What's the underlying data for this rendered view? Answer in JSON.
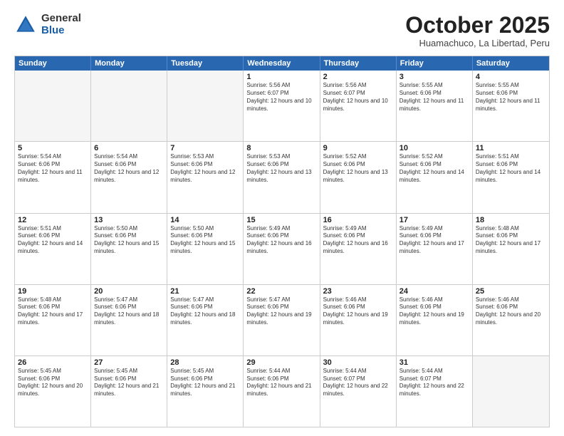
{
  "logo": {
    "general": "General",
    "blue": "Blue"
  },
  "header": {
    "month": "October 2025",
    "location": "Huamachuco, La Libertad, Peru"
  },
  "weekdays": [
    "Sunday",
    "Monday",
    "Tuesday",
    "Wednesday",
    "Thursday",
    "Friday",
    "Saturday"
  ],
  "rows": [
    [
      {
        "day": "",
        "empty": true
      },
      {
        "day": "",
        "empty": true
      },
      {
        "day": "",
        "empty": true
      },
      {
        "day": "1",
        "sunrise": "5:56 AM",
        "sunset": "6:07 PM",
        "daylight": "12 hours and 10 minutes."
      },
      {
        "day": "2",
        "sunrise": "5:56 AM",
        "sunset": "6:07 PM",
        "daylight": "12 hours and 10 minutes."
      },
      {
        "day": "3",
        "sunrise": "5:55 AM",
        "sunset": "6:06 PM",
        "daylight": "12 hours and 11 minutes."
      },
      {
        "day": "4",
        "sunrise": "5:55 AM",
        "sunset": "6:06 PM",
        "daylight": "12 hours and 11 minutes."
      }
    ],
    [
      {
        "day": "5",
        "sunrise": "5:54 AM",
        "sunset": "6:06 PM",
        "daylight": "12 hours and 11 minutes."
      },
      {
        "day": "6",
        "sunrise": "5:54 AM",
        "sunset": "6:06 PM",
        "daylight": "12 hours and 12 minutes."
      },
      {
        "day": "7",
        "sunrise": "5:53 AM",
        "sunset": "6:06 PM",
        "daylight": "12 hours and 12 minutes."
      },
      {
        "day": "8",
        "sunrise": "5:53 AM",
        "sunset": "6:06 PM",
        "daylight": "12 hours and 13 minutes."
      },
      {
        "day": "9",
        "sunrise": "5:52 AM",
        "sunset": "6:06 PM",
        "daylight": "12 hours and 13 minutes."
      },
      {
        "day": "10",
        "sunrise": "5:52 AM",
        "sunset": "6:06 PM",
        "daylight": "12 hours and 14 minutes."
      },
      {
        "day": "11",
        "sunrise": "5:51 AM",
        "sunset": "6:06 PM",
        "daylight": "12 hours and 14 minutes."
      }
    ],
    [
      {
        "day": "12",
        "sunrise": "5:51 AM",
        "sunset": "6:06 PM",
        "daylight": "12 hours and 14 minutes."
      },
      {
        "day": "13",
        "sunrise": "5:50 AM",
        "sunset": "6:06 PM",
        "daylight": "12 hours and 15 minutes."
      },
      {
        "day": "14",
        "sunrise": "5:50 AM",
        "sunset": "6:06 PM",
        "daylight": "12 hours and 15 minutes."
      },
      {
        "day": "15",
        "sunrise": "5:49 AM",
        "sunset": "6:06 PM",
        "daylight": "12 hours and 16 minutes."
      },
      {
        "day": "16",
        "sunrise": "5:49 AM",
        "sunset": "6:06 PM",
        "daylight": "12 hours and 16 minutes."
      },
      {
        "day": "17",
        "sunrise": "5:49 AM",
        "sunset": "6:06 PM",
        "daylight": "12 hours and 17 minutes."
      },
      {
        "day": "18",
        "sunrise": "5:48 AM",
        "sunset": "6:06 PM",
        "daylight": "12 hours and 17 minutes."
      }
    ],
    [
      {
        "day": "19",
        "sunrise": "5:48 AM",
        "sunset": "6:06 PM",
        "daylight": "12 hours and 17 minutes."
      },
      {
        "day": "20",
        "sunrise": "5:47 AM",
        "sunset": "6:06 PM",
        "daylight": "12 hours and 18 minutes."
      },
      {
        "day": "21",
        "sunrise": "5:47 AM",
        "sunset": "6:06 PM",
        "daylight": "12 hours and 18 minutes."
      },
      {
        "day": "22",
        "sunrise": "5:47 AM",
        "sunset": "6:06 PM",
        "daylight": "12 hours and 19 minutes."
      },
      {
        "day": "23",
        "sunrise": "5:46 AM",
        "sunset": "6:06 PM",
        "daylight": "12 hours and 19 minutes."
      },
      {
        "day": "24",
        "sunrise": "5:46 AM",
        "sunset": "6:06 PM",
        "daylight": "12 hours and 19 minutes."
      },
      {
        "day": "25",
        "sunrise": "5:46 AM",
        "sunset": "6:06 PM",
        "daylight": "12 hours and 20 minutes."
      }
    ],
    [
      {
        "day": "26",
        "sunrise": "5:45 AM",
        "sunset": "6:06 PM",
        "daylight": "12 hours and 20 minutes."
      },
      {
        "day": "27",
        "sunrise": "5:45 AM",
        "sunset": "6:06 PM",
        "daylight": "12 hours and 21 minutes."
      },
      {
        "day": "28",
        "sunrise": "5:45 AM",
        "sunset": "6:06 PM",
        "daylight": "12 hours and 21 minutes."
      },
      {
        "day": "29",
        "sunrise": "5:44 AM",
        "sunset": "6:06 PM",
        "daylight": "12 hours and 21 minutes."
      },
      {
        "day": "30",
        "sunrise": "5:44 AM",
        "sunset": "6:07 PM",
        "daylight": "12 hours and 22 minutes."
      },
      {
        "day": "31",
        "sunrise": "5:44 AM",
        "sunset": "6:07 PM",
        "daylight": "12 hours and 22 minutes."
      },
      {
        "day": "",
        "empty": true
      }
    ]
  ]
}
